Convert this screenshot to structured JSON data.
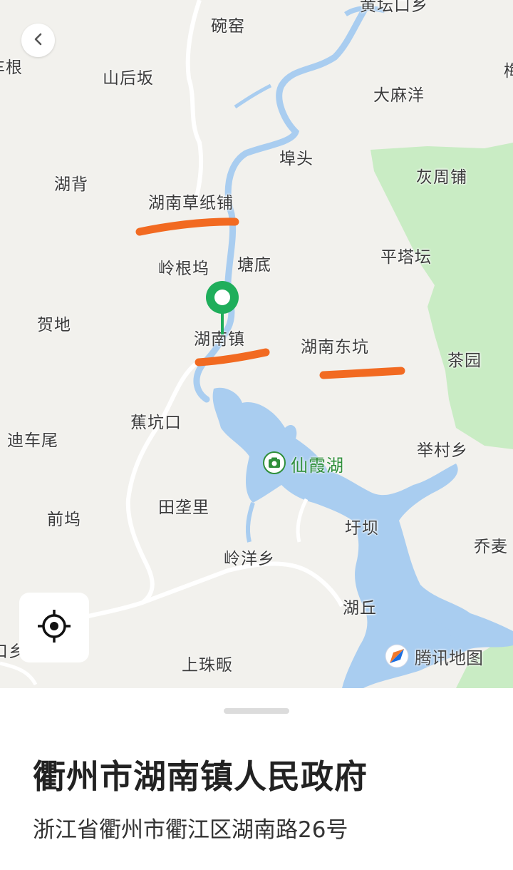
{
  "map": {
    "labels": {
      "top_partial": "黄坛口乡",
      "wanyao": "碗窑",
      "left_partial_top": "车根",
      "shanhouban": "山后坂",
      "right_partial_top": "梅",
      "damayang": "大麻洋",
      "butou": "埠头",
      "hubei": "湖背",
      "huizhoupu": "灰周铺",
      "hunancaozhipu": "湖南草纸铺",
      "linggenwu": "岭根坞",
      "tangdi": "塘底",
      "pingtatan": "平塔坛",
      "hedi": "贺地",
      "hunanzhen": "湖南镇",
      "hunandongkeng": "湖南东坑",
      "chayuan": "茶园",
      "jiaokengkou": "蕉坑口",
      "dichewei": "迪车尾",
      "jucunxiang": "举村乡",
      "qianwu": "前坞",
      "tianlongli": "田垄里",
      "xuba": "圩坝",
      "qiaomai": "乔麦",
      "lingyangxiang": "岭洋乡",
      "huqiu": "湖丘",
      "left_partial_bottom": "口乡",
      "shangzhufan": "上珠畈"
    },
    "poi": {
      "name": "仙霞湖",
      "icon": "camera-icon",
      "color": "#2f8f3a"
    },
    "marker": {
      "icon": "location-pin-icon",
      "color": "#1fae5b"
    },
    "annotation_color": "#f26a21",
    "water_color": "#a9cdf0",
    "forest_color": "#c9ecc4",
    "back_icon": "chevron-left-icon",
    "locate_icon": "crosshair-icon",
    "watermark": {
      "icon": "tencent-maps-logo-icon",
      "text": "腾讯地图"
    }
  },
  "place": {
    "name": "衢州市湖南镇人民政府",
    "address": "浙江省衢州市衢江区湖南路26号"
  }
}
